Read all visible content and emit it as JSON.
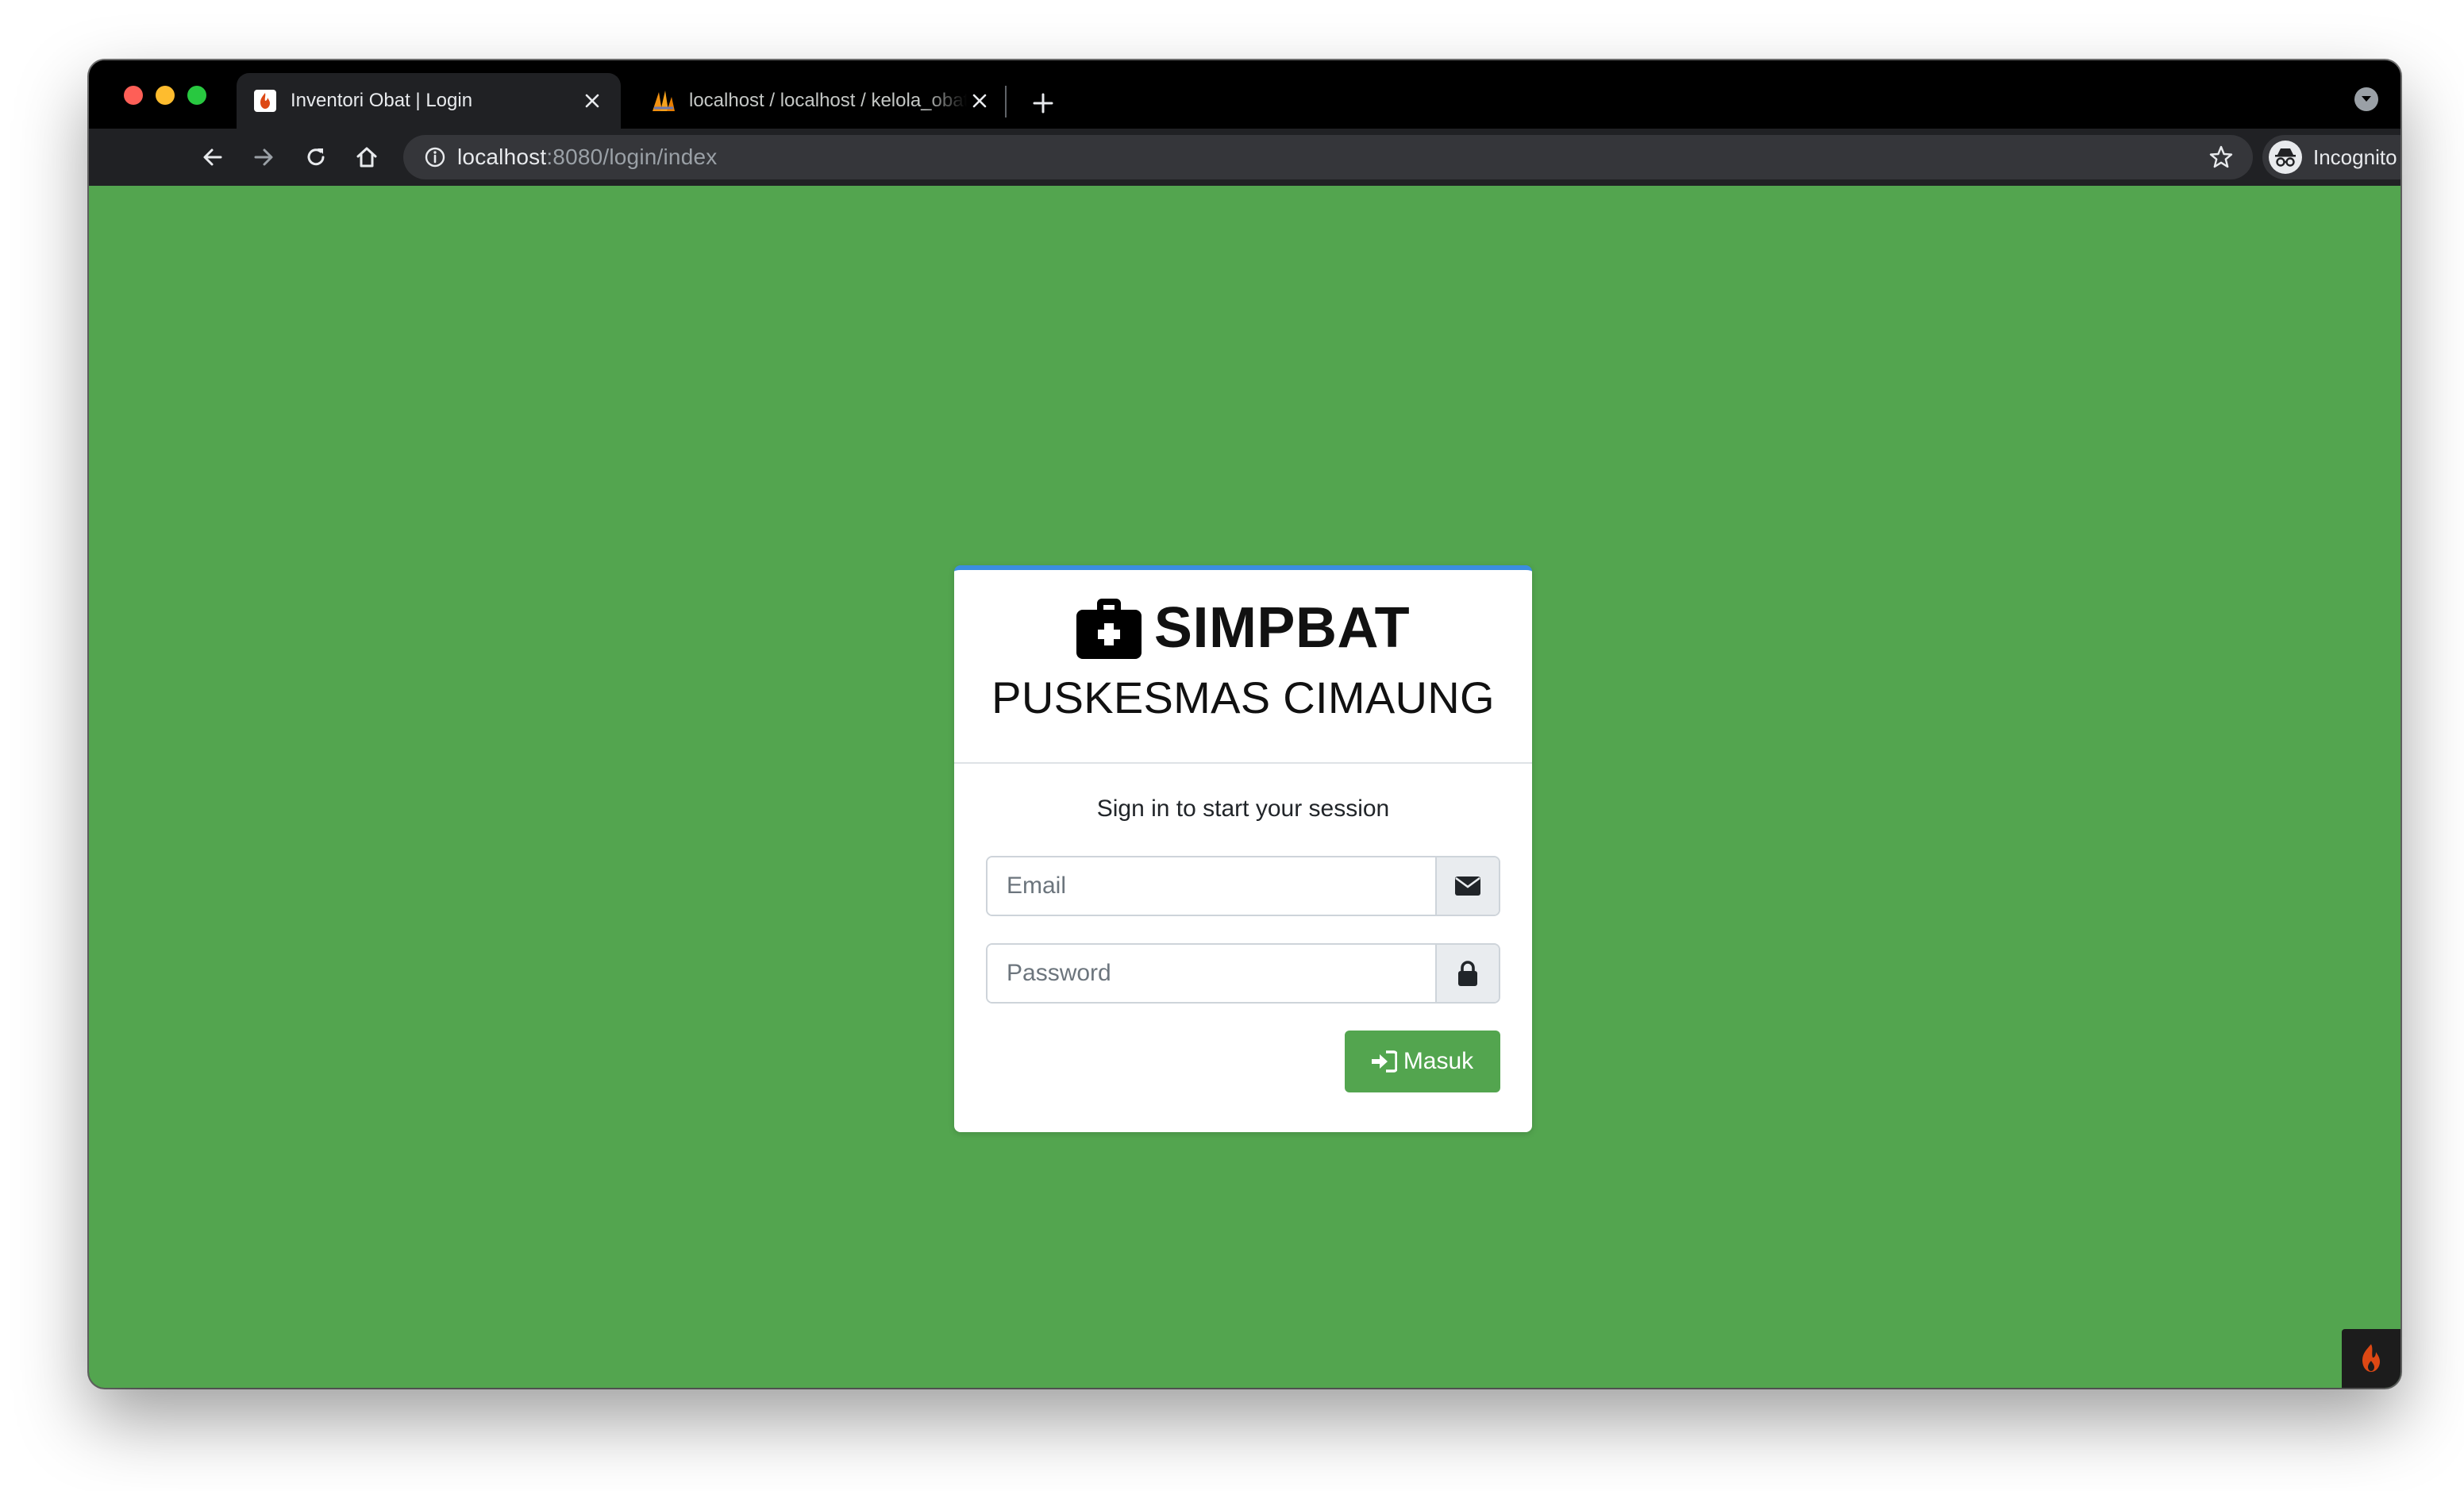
{
  "browser": {
    "tabs": [
      {
        "title": "Inventori Obat | Login",
        "active": true,
        "favicon": "codeigniter-flame-icon"
      },
      {
        "title": "localhost / localhost / kelola_obat",
        "active": false,
        "favicon": "phpmyadmin-sail-icon"
      }
    ],
    "url_host": "localhost",
    "url_path": ":8080/login/index",
    "profile_label": "Incognito"
  },
  "page": {
    "background_color": "#53a54f",
    "brand_icon": "medkit-icon",
    "brand_name": "SIMPBAT",
    "org_name": "PUSKESMAS CIMAUNG",
    "login_message": "Sign in to start your session",
    "email_placeholder": "Email",
    "email_icon": "envelope-icon",
    "password_placeholder": "Password",
    "password_icon": "lock-icon",
    "submit_label": "Masuk",
    "submit_icon": "sign-in-icon",
    "accent_color": "#3b8ee0"
  }
}
